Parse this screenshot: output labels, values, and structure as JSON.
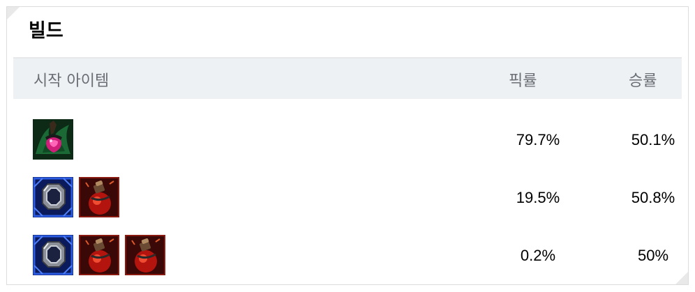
{
  "section": {
    "title": "빌드"
  },
  "table": {
    "headers": {
      "items": "시작 아이템",
      "pick_rate": "픽률",
      "win_rate": "승률"
    },
    "rows": [
      {
        "items": [
          "dark-seal-icon"
        ],
        "pick_rate": "79.7%",
        "win_rate": "50.1%"
      },
      {
        "items": [
          "dorans-ring-icon",
          "health-potion-icon"
        ],
        "pick_rate": "19.5%",
        "win_rate": "50.8%"
      },
      {
        "items": [
          "dorans-ring-icon",
          "health-potion-icon",
          "health-potion-icon"
        ],
        "pick_rate": "0.2%",
        "win_rate": "50%"
      }
    ]
  },
  "colors": {
    "header_bg": "#eef1f4",
    "header_text": "#6a6f75",
    "border": "#dcdcdc"
  }
}
